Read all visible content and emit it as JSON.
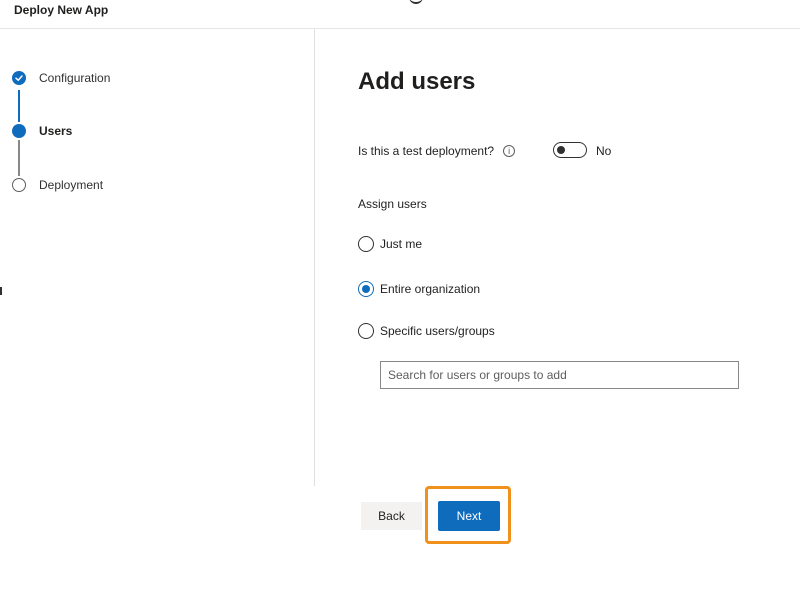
{
  "header": {
    "title": "Deploy New App"
  },
  "stepper": {
    "steps": [
      {
        "label": "Configuration",
        "state": "completed"
      },
      {
        "label": "Users",
        "state": "current"
      },
      {
        "label": "Deployment",
        "state": "pending"
      }
    ]
  },
  "main": {
    "heading": "Add users",
    "test_deployment": {
      "question": "Is this a test deployment?",
      "toggle_on": false,
      "toggle_text": "No"
    },
    "assign_users": {
      "label": "Assign users",
      "options": [
        {
          "label": "Just me",
          "selected": false
        },
        {
          "label": "Entire organization",
          "selected": true
        },
        {
          "label": "Specific users/groups",
          "selected": false
        }
      ],
      "search_value": "",
      "search_placeholder": "Search for users or groups to add"
    }
  },
  "buttons": {
    "back": "Back",
    "next": "Next"
  },
  "colors": {
    "accent": "#0f6cbd",
    "highlight": "#f0911b"
  }
}
